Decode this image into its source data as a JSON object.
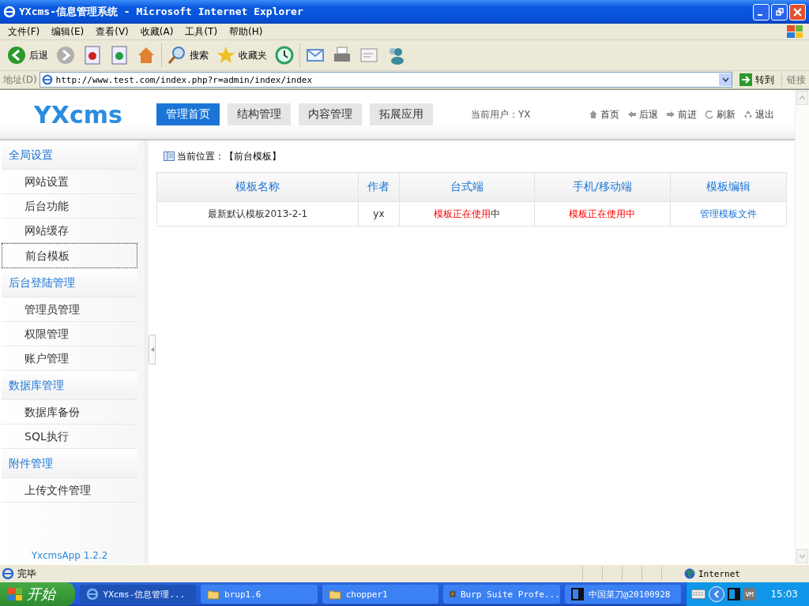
{
  "window": {
    "title": "YXcms-信息管理系统 - Microsoft Internet Explorer"
  },
  "menu_bar": [
    "文件(F)",
    "编辑(E)",
    "查看(V)",
    "收藏(A)",
    "工具(T)",
    "帮助(H)"
  ],
  "toolbar": [
    {
      "kind": "back",
      "label": "后退"
    },
    {
      "kind": "forward"
    },
    {
      "kind": "stop"
    },
    {
      "kind": "refresh"
    },
    {
      "kind": "home"
    },
    {
      "kind": "search",
      "label": "搜索"
    },
    {
      "kind": "favorites",
      "label": "收藏夹"
    },
    {
      "kind": "history"
    },
    {
      "kind": "mail"
    },
    {
      "kind": "print"
    },
    {
      "kind": "edit"
    },
    {
      "kind": "messenger"
    }
  ],
  "address_bar": {
    "label": "地址(D)",
    "value": "http://www.test.com/index.php?r=admin/index/index",
    "go": "转到",
    "links": "链接"
  },
  "header": {
    "logo": "YXcms",
    "nav": [
      {
        "label": "管理首页",
        "selected": true
      },
      {
        "label": "结构管理",
        "selected": false
      },
      {
        "label": "内容管理",
        "selected": false
      },
      {
        "label": "拓展应用",
        "selected": false
      }
    ],
    "current_user": "当前用户：YX",
    "links": [
      {
        "kind": "home",
        "label": "首页"
      },
      {
        "kind": "back",
        "label": "后退"
      },
      {
        "kind": "forward",
        "label": "前进"
      },
      {
        "kind": "refresh",
        "label": "刷新"
      },
      {
        "kind": "logout",
        "label": "退出"
      }
    ]
  },
  "sidebar": {
    "groups": [
      {
        "title": "全局设置",
        "items": [
          {
            "label": "网站设置",
            "selected": false
          },
          {
            "label": "后台功能",
            "selected": false
          },
          {
            "label": "网站缓存",
            "selected": false
          },
          {
            "label": "前台模板",
            "selected": true
          }
        ]
      },
      {
        "title": "后台登陆管理",
        "items": [
          {
            "label": "管理员管理",
            "selected": false
          },
          {
            "label": "权限管理",
            "selected": false
          },
          {
            "label": "账户管理",
            "selected": false
          }
        ]
      },
      {
        "title": "数据库管理",
        "items": [
          {
            "label": "数据库备份",
            "selected": false
          },
          {
            "label": "SQL执行",
            "selected": false
          }
        ]
      },
      {
        "title": "附件管理",
        "items": [
          {
            "label": "上传文件管理",
            "selected": false
          }
        ]
      }
    ],
    "footer": "YxcmsApp 1.2.2"
  },
  "breadcrumb": "当前位置：【前台模板】",
  "table": {
    "columns": [
      "模板名称",
      "作者",
      "台式端",
      "手机/移动端",
      "模板编辑"
    ],
    "rows": [
      {
        "name": "最新默认模板2013-2-1",
        "author": "yx",
        "desktop": {
          "status": "模板正在使用",
          "suffix": "中"
        },
        "mobile": {
          "status": "模板正在使用中"
        },
        "edit_link": "管理模板文件"
      }
    ]
  },
  "status_bar": {
    "text": "完毕",
    "zone": "Internet"
  },
  "taskbar": {
    "start": "开始",
    "items": [
      {
        "kind": "ie",
        "label": "YXcms-信息管理...",
        "selected": true
      },
      {
        "kind": "folder",
        "label": "brup1.6",
        "selected": false
      },
      {
        "kind": "folder",
        "label": "chopper1",
        "selected": false
      },
      {
        "kind": "burp",
        "label": "Burp Suite Profe...",
        "selected": false
      },
      {
        "kind": "window",
        "label": "中国菜刀@20100928",
        "selected": false
      }
    ],
    "clock": "15:03"
  }
}
